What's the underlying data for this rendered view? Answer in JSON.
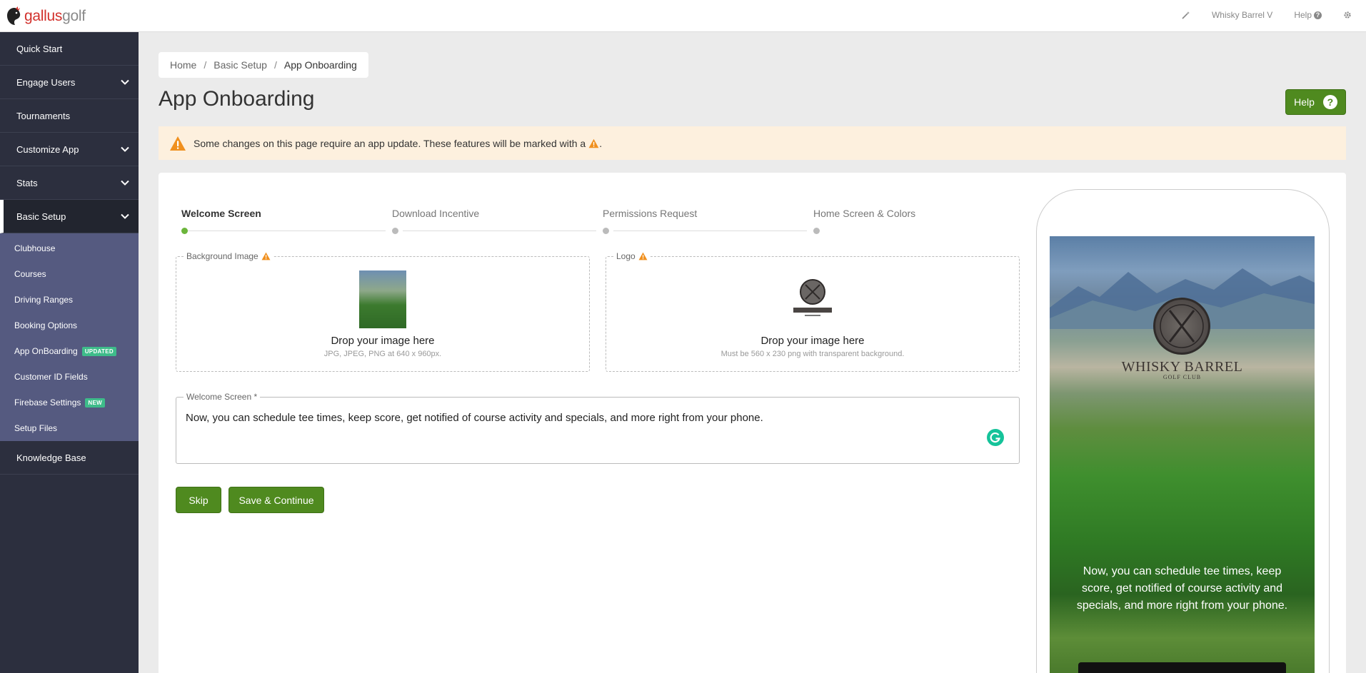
{
  "brand": {
    "name_part1": "gallus",
    "name_part2": "golf",
    "color": "#d2312c"
  },
  "topbar": {
    "course_name": "Whisky Barrel V",
    "help_label": "Help"
  },
  "sidebar": {
    "items": [
      {
        "label": "Quick Start",
        "has_chevron": false
      },
      {
        "label": "Engage Users",
        "has_chevron": true
      },
      {
        "label": "Tournaments",
        "has_chevron": false
      },
      {
        "label": "Customize App",
        "has_chevron": true
      },
      {
        "label": "Stats",
        "has_chevron": true
      },
      {
        "label": "Basic Setup",
        "has_chevron": true,
        "active": true
      }
    ],
    "sub_items": [
      {
        "label": "Clubhouse"
      },
      {
        "label": "Courses"
      },
      {
        "label": "Driving Ranges"
      },
      {
        "label": "Booking Options"
      },
      {
        "label": "App OnBoarding",
        "badge": "UPDATED"
      },
      {
        "label": "Customer ID Fields"
      },
      {
        "label": "Firebase Settings",
        "badge": "NEW"
      },
      {
        "label": "Setup Files"
      }
    ],
    "bottom_item": {
      "label": "Knowledge Base"
    }
  },
  "breadcrumb": {
    "home": "Home",
    "section": "Basic Setup",
    "current": "App Onboarding"
  },
  "page": {
    "title": "App Onboarding",
    "help_button": "Help"
  },
  "alert": {
    "text": "Some changes on this page require an app update. These features will be marked with a",
    "end": "."
  },
  "steps": [
    {
      "label": "Welcome Screen",
      "active": true
    },
    {
      "label": "Download Incentive",
      "active": false
    },
    {
      "label": "Permissions Request",
      "active": false
    },
    {
      "label": "Home Screen & Colors",
      "active": false
    }
  ],
  "background_image": {
    "legend": "Background Image",
    "title": "Drop your image here",
    "hint": "JPG, JPEG, PNG at 640 x 960px."
  },
  "logo": {
    "legend": "Logo",
    "title": "Drop your image here",
    "hint": "Must be 560 x 230 png with transparent background."
  },
  "welcome_screen": {
    "legend": "Welcome Screen *",
    "value": "Now, you can schedule tee times, keep score, get notified of course activity and specials, and more right from your phone."
  },
  "buttons": {
    "skip": "Skip",
    "save": "Save & Continue"
  },
  "preview": {
    "emblem_title": "WHISKY BARREL",
    "emblem_sub": "GOLF CLUB",
    "message": "Now, you can schedule tee times, keep score, get notified of course activity and specials, and more right from your phone."
  },
  "colors": {
    "primary_green": "#4f8a1f",
    "sidebar_bg": "#2c2f3e",
    "subnav_bg": "#555a80",
    "alert_bg": "#fdf0de",
    "warning": "#f0901e"
  }
}
